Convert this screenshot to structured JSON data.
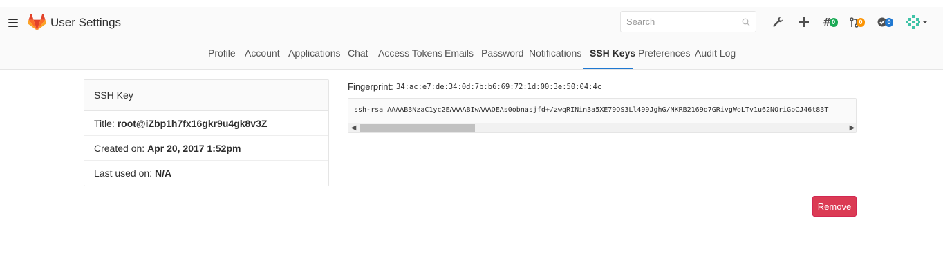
{
  "header": {
    "title": "User Settings",
    "search_placeholder": "Search",
    "icons": [
      "hamburger-icon",
      "gitlab-logo",
      "wrench-icon",
      "plus-icon",
      "issues-icon",
      "merge-request-icon",
      "todo-icon",
      "avatar"
    ],
    "issues_count": "0",
    "merge_requests_count": "0",
    "todos_count": "0",
    "colors": {
      "issues_badge": "#1aaa55",
      "mr_badge": "#fc9403",
      "todo_badge": "#1f78d1",
      "accent": "#1f78d1"
    }
  },
  "nav": {
    "tabs": [
      "Profile",
      "Account",
      "Applications",
      "Chat",
      "Access Tokens",
      "Emails",
      "Password",
      "Notifications",
      "SSH Keys",
      "Preferences",
      "Audit Log"
    ],
    "active_tab": "SSH Keys"
  },
  "ssh_key": {
    "panel_title": "SSH Key",
    "title_label": "Title:",
    "title_value": "root@iZbp1h7fx16gkr9u4gk8v3Z",
    "created_label": "Created on:",
    "created_value": "Apr 20, 2017 1:52pm",
    "last_used_label": "Last used on:",
    "last_used_value": "N/A",
    "fingerprint_label": "Fingerprint:",
    "fingerprint_value": "34:ac:e7:de:34:0d:7b:b6:69:72:1d:00:3e:50:04:4c",
    "key_text": "ssh-rsa AAAAB3NzaC1yc2EAAAABIwAAAQEAs0obnasjfd+/zwqRINin3a5XE79OS3Ll499JghG/NKRB2169o7GRivgWoLTv1u62NQriGpCJ46t83T",
    "remove_label": "Remove",
    "remove_color": "#db3b54"
  }
}
